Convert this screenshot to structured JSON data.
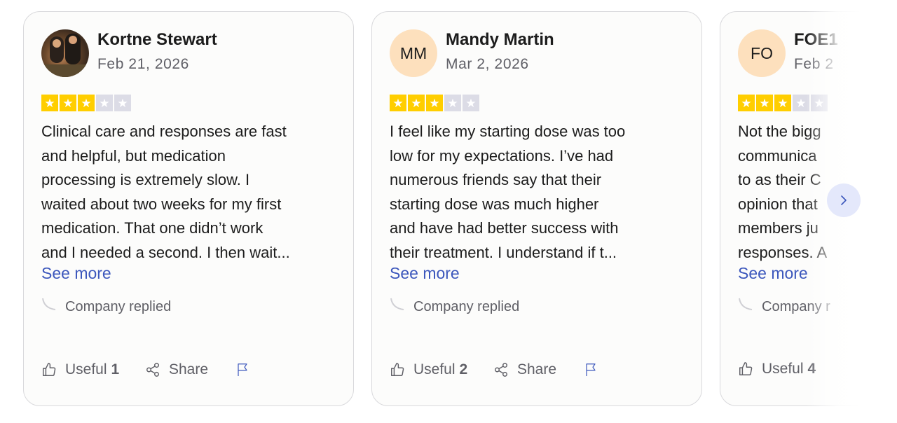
{
  "reviews": [
    {
      "avatar_type": "photo",
      "avatar_initials": "",
      "name": "Kortne Stewart",
      "date": "Feb 21, 2026",
      "rating": 3,
      "body_lines": [
        "Clinical care and responses are fast",
        "and helpful, but medication",
        "processing is extremely slow. I",
        "waited about two weeks for my first",
        "medication. That one didn’t work",
        "and I needed a second. I then wait..."
      ],
      "see_more": "See more",
      "replied": "Company replied",
      "useful_label": "Useful",
      "useful_count": "1",
      "share_label": "Share"
    },
    {
      "avatar_type": "initials",
      "avatar_initials": "MM",
      "name": "Mandy Martin",
      "date": "Mar 2, 2026",
      "rating": 3,
      "body_lines": [
        "I feel like my starting dose was too",
        "low for my expectations. I’ve had",
        "numerous friends say that their",
        "starting dose was much higher",
        "and have had better success with",
        "their treatment. I understand if t..."
      ],
      "see_more": "See more",
      "replied": "Company replied",
      "useful_label": "Useful",
      "useful_count": "2",
      "share_label": "Share"
    },
    {
      "avatar_type": "initials",
      "avatar_initials": "FO",
      "name": "FOE1",
      "date": "Feb 2",
      "rating": 3,
      "body_lines": [
        "Not the bigg",
        "communica",
        "to as their C",
        "opinion that",
        "members ju",
        "responses. A"
      ],
      "see_more": "See more",
      "replied": "Company r",
      "useful_label": "Useful",
      "useful_count": "4",
      "share_label": ""
    }
  ],
  "colors": {
    "star_on": "#ffce00",
    "star_off": "#dcdce6",
    "link": "#3c57bc",
    "avatar_bg": "#fde0bd",
    "next_button_bg": "#e4e8fb"
  },
  "icons": [
    "thumbs-up-icon",
    "share-icon",
    "flag-icon",
    "reply-curve-icon",
    "star-icon",
    "chevron-right-icon"
  ]
}
